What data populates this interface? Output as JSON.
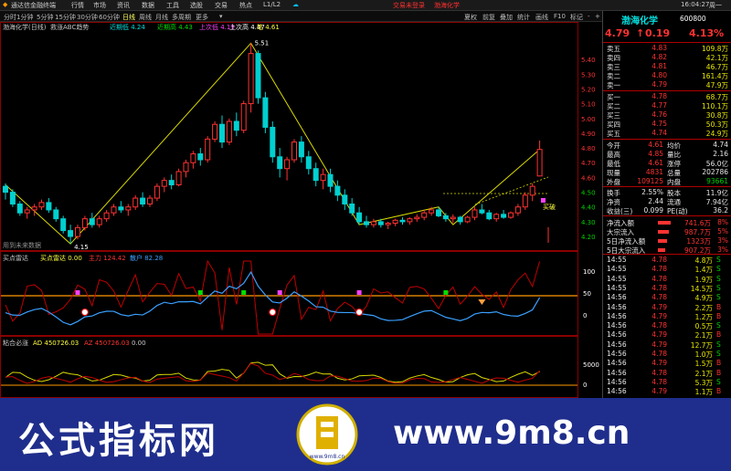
{
  "titlebar": {
    "app_name": "通达信金融终端",
    "menus": [
      "行情",
      "市场",
      "资讯",
      "数据",
      "工具",
      "选股",
      "交易",
      "热点",
      "L1/L2"
    ],
    "center_red_1": "交易未登录",
    "center_red_2": "渤海化学",
    "right_items": [
      "夏权",
      "前复",
      "叠加",
      "统计",
      "画线",
      "F10",
      "标记",
      "-",
      "+"
    ],
    "time": "16:04:27",
    "weekday": "周一"
  },
  "periodbar": {
    "items": [
      "分时",
      "1分钟",
      "5分钟",
      "15分钟",
      "30分钟",
      "60分钟",
      "日线",
      "周线",
      "月线",
      "多周期",
      "更多"
    ]
  },
  "main_chart": {
    "stock_label": "渤海化学(日线)",
    "indicator_label": "救涨ABC趋势",
    "legend_1": "近期低 4.24",
    "legend_2": "近期高 4.43",
    "legend_3": "上次低 4.19",
    "legend_4": "上次高 4.47",
    "legend_5": "笔 4.61",
    "high_marker": "5.51",
    "low_marker": "4.15",
    "buy_tag": "买破",
    "bottom_note": "用到未来数据"
  },
  "sub1": {
    "name": "买点雷达",
    "v1": "买点雷达 0.00",
    "v2": "主力 124.42",
    "v3": "散户 82.28",
    "scale": [
      "100",
      "50",
      "0"
    ]
  },
  "sub2": {
    "name": "粘合必涨",
    "v1": "AD 450726.03",
    "v2": "AZ 450726.03",
    "v3": "0.00",
    "scale": [
      "5000",
      "0"
    ]
  },
  "quote": {
    "name": "渤海化学",
    "code": "600800",
    "price": "4.79",
    "change": "0.19",
    "pct": "4.13%",
    "sells": [
      {
        "label": "卖五",
        "price": "4.83",
        "vol": "109.8万"
      },
      {
        "label": "卖四",
        "price": "4.82",
        "vol": "42.1万"
      },
      {
        "label": "卖三",
        "price": "4.81",
        "vol": "46.7万"
      },
      {
        "label": "卖二",
        "price": "4.80",
        "vol": "161.4万"
      },
      {
        "label": "卖一",
        "price": "4.79",
        "vol": "47.9万"
      }
    ],
    "buys": [
      {
        "label": "买一",
        "price": "4.78",
        "vol": "68.7万"
      },
      {
        "label": "买二",
        "price": "4.77",
        "vol": "110.1万"
      },
      {
        "label": "买三",
        "price": "4.76",
        "vol": "30.8万"
      },
      {
        "label": "买四",
        "price": "4.75",
        "vol": "50.3万"
      },
      {
        "label": "买五",
        "price": "4.74",
        "vol": "24.9万"
      }
    ],
    "stats": [
      {
        "l1": "今开",
        "v1": "4.61",
        "l2": "均价",
        "v2": "4.74"
      },
      {
        "l1": "最高",
        "v1": "4.85",
        "l2": "量比",
        "v2": "2.16"
      },
      {
        "l1": "最低",
        "v1": "4.61",
        "l2": "涨停",
        "v2": "56.0亿"
      },
      {
        "l1": "现量",
        "v1": "4831",
        "l2": "总量",
        "v2": "202786"
      },
      {
        "l1": "外盘",
        "v1": "109125",
        "l2": "内盘",
        "v2": "93661"
      }
    ],
    "stats2": [
      {
        "l1": "换手",
        "v1": "2.55%",
        "l2": "股本",
        "v2": "11.9亿"
      },
      {
        "l1": "净资",
        "v1": "2.44",
        "l2": "流通",
        "v2": "7.94亿"
      },
      {
        "l1": "收益(三)",
        "v1": "0.099",
        "l2": "PE(动)",
        "v2": "36.2"
      }
    ],
    "flows": [
      {
        "label": "净流入额",
        "val": "741.6万",
        "pct": "8%"
      },
      {
        "label": "大宗流入",
        "val": "987.7万",
        "pct": "5%"
      },
      {
        "label": "5日净流入额",
        "val": "1323万",
        "pct": "3%"
      },
      {
        "label": "5日大宗流入",
        "val": "907.2万",
        "pct": "3%"
      }
    ],
    "ticks": [
      {
        "t": "14:55",
        "p": "4.78",
        "v": "4.8万",
        "d": "S"
      },
      {
        "t": "14:55",
        "p": "4.78",
        "v": "1.4万",
        "d": "S"
      },
      {
        "t": "14:55",
        "p": "4.78",
        "v": "1.9万",
        "d": "S"
      },
      {
        "t": "14:55",
        "p": "4.78",
        "v": "14.5万",
        "d": "S"
      },
      {
        "t": "14:56",
        "p": "4.78",
        "v": "4.9万",
        "d": "S"
      },
      {
        "t": "14:56",
        "p": "4.79",
        "v": "2.2万",
        "d": "B"
      },
      {
        "t": "14:56",
        "p": "4.79",
        "v": "1.2万",
        "d": "B"
      },
      {
        "t": "14:56",
        "p": "4.78",
        "v": "0.5万",
        "d": "S"
      },
      {
        "t": "14:56",
        "p": "4.79",
        "v": "2.1万",
        "d": "B"
      },
      {
        "t": "14:56",
        "p": "4.79",
        "v": "12.7万",
        "d": "S"
      },
      {
        "t": "14:56",
        "p": "4.78",
        "v": "1.0万",
        "d": "S"
      },
      {
        "t": "14:56",
        "p": "4.79",
        "v": "1.5万",
        "d": "B"
      },
      {
        "t": "14:56",
        "p": "4.78",
        "v": "2.1万",
        "d": "B"
      },
      {
        "t": "14:56",
        "p": "4.78",
        "v": "5.3万",
        "d": "S"
      },
      {
        "t": "14:56",
        "p": "4.79",
        "v": "1.1万",
        "d": "B"
      }
    ]
  },
  "price_axis": [
    "5.40",
    "5.30",
    "5.20",
    "5.10",
    "5.00",
    "4.90",
    "4.80",
    "4.70",
    "4.60",
    "4.50",
    "4.40",
    "4.30",
    "4.20"
  ],
  "banner": {
    "left_text": "公式指标网",
    "right_text": "www.9m8.cn",
    "logo_text": "www.9m8.cn"
  },
  "colors": {
    "up": "#ff3232",
    "down": "#00d0d0",
    "zigzag": "#d8d800",
    "banner_bg": "#1f2e8c"
  },
  "chart_data": {
    "type": "candlestick",
    "candles": [
      [
        4.54,
        4.56,
        4.45,
        4.5
      ],
      [
        4.5,
        4.52,
        4.4,
        4.42
      ],
      [
        4.42,
        4.44,
        4.34,
        4.36
      ],
      [
        4.36,
        4.4,
        4.32,
        4.38
      ],
      [
        4.38,
        4.42,
        4.34,
        4.4
      ],
      [
        4.4,
        4.45,
        4.38,
        4.43
      ],
      [
        4.43,
        4.46,
        4.36,
        4.38
      ],
      [
        4.38,
        4.4,
        4.3,
        4.32
      ],
      [
        4.32,
        4.34,
        4.22,
        4.24
      ],
      [
        4.24,
        4.28,
        4.15,
        4.2
      ],
      [
        4.2,
        4.28,
        4.18,
        4.26
      ],
      [
        4.26,
        4.34,
        4.24,
        4.32
      ],
      [
        4.32,
        4.36,
        4.26,
        4.28
      ],
      [
        4.28,
        4.34,
        4.26,
        4.32
      ],
      [
        4.32,
        4.38,
        4.3,
        4.36
      ],
      [
        4.36,
        4.42,
        4.34,
        4.4
      ],
      [
        4.4,
        4.44,
        4.36,
        4.38
      ],
      [
        4.38,
        4.42,
        4.34,
        4.4
      ],
      [
        4.4,
        4.48,
        4.38,
        4.46
      ],
      [
        4.46,
        4.5,
        4.4,
        4.42
      ],
      [
        4.42,
        4.48,
        4.4,
        4.46
      ],
      [
        4.46,
        4.56,
        4.44,
        4.54
      ],
      [
        4.54,
        4.6,
        4.5,
        4.58
      ],
      [
        4.58,
        4.62,
        4.52,
        4.55
      ],
      [
        4.55,
        4.66,
        4.54,
        4.64
      ],
      [
        4.64,
        4.72,
        4.6,
        4.7
      ],
      [
        4.7,
        4.78,
        4.66,
        4.76
      ],
      [
        4.76,
        4.8,
        4.68,
        4.72
      ],
      [
        4.72,
        4.88,
        4.7,
        4.86
      ],
      [
        4.86,
        4.98,
        4.84,
        4.96
      ],
      [
        4.96,
        5.02,
        4.8,
        4.84
      ],
      [
        4.84,
        5.0,
        4.82,
        4.98
      ],
      [
        4.98,
        5.04,
        4.88,
        4.92
      ],
      [
        4.92,
        5.12,
        4.9,
        5.1
      ],
      [
        5.1,
        5.51,
        5.04,
        5.44
      ],
      [
        5.44,
        5.46,
        5.1,
        5.14
      ],
      [
        5.14,
        5.18,
        4.9,
        4.94
      ],
      [
        4.94,
        4.98,
        4.7,
        4.74
      ],
      [
        4.74,
        4.8,
        4.6,
        4.66
      ],
      [
        4.66,
        4.74,
        4.58,
        4.72
      ],
      [
        4.72,
        4.86,
        4.7,
        4.84
      ],
      [
        4.84,
        4.88,
        4.7,
        4.74
      ],
      [
        4.74,
        4.78,
        4.62,
        4.66
      ],
      [
        4.66,
        4.7,
        4.54,
        4.58
      ],
      [
        4.58,
        4.66,
        4.52,
        4.62
      ],
      [
        4.62,
        4.66,
        4.5,
        4.54
      ],
      [
        4.54,
        4.58,
        4.44,
        4.48
      ],
      [
        4.48,
        4.52,
        4.38,
        4.42
      ],
      [
        4.42,
        4.46,
        4.34,
        4.36
      ],
      [
        4.36,
        4.4,
        4.28,
        4.3
      ],
      [
        4.3,
        4.34,
        4.26,
        4.28
      ],
      [
        4.28,
        4.32,
        4.26,
        4.3
      ],
      [
        4.3,
        4.32,
        4.26,
        4.28
      ],
      [
        4.28,
        4.3,
        4.25,
        4.29
      ],
      [
        4.29,
        4.32,
        4.27,
        4.31
      ],
      [
        4.31,
        4.33,
        4.28,
        4.3
      ],
      [
        4.3,
        4.33,
        4.28,
        4.32
      ],
      [
        4.32,
        4.35,
        4.3,
        4.33
      ],
      [
        4.33,
        4.38,
        4.31,
        4.36
      ],
      [
        4.36,
        4.4,
        4.34,
        4.38
      ],
      [
        4.38,
        4.4,
        4.33,
        4.34
      ],
      [
        4.34,
        4.36,
        4.3,
        4.32
      ],
      [
        4.32,
        4.35,
        4.29,
        4.33
      ],
      [
        4.33,
        4.34,
        4.28,
        4.3
      ],
      [
        4.3,
        4.34,
        4.29,
        4.33
      ],
      [
        4.33,
        4.4,
        4.31,
        4.38
      ],
      [
        4.38,
        4.42,
        4.35,
        4.36
      ],
      [
        4.36,
        4.38,
        4.31,
        4.32
      ],
      [
        4.32,
        4.36,
        4.3,
        4.35
      ],
      [
        4.35,
        4.38,
        4.32,
        4.33
      ],
      [
        4.33,
        4.37,
        4.32,
        4.36
      ],
      [
        4.36,
        4.42,
        4.34,
        4.4
      ],
      [
        4.4,
        4.5,
        4.38,
        4.48
      ],
      [
        4.48,
        4.56,
        4.44,
        4.54
      ],
      [
        4.61,
        4.85,
        4.61,
        4.79
      ]
    ],
    "title": "",
    "xlabel": "",
    "ylabel": "",
    "ylim": [
      4.15,
      5.51
    ]
  }
}
